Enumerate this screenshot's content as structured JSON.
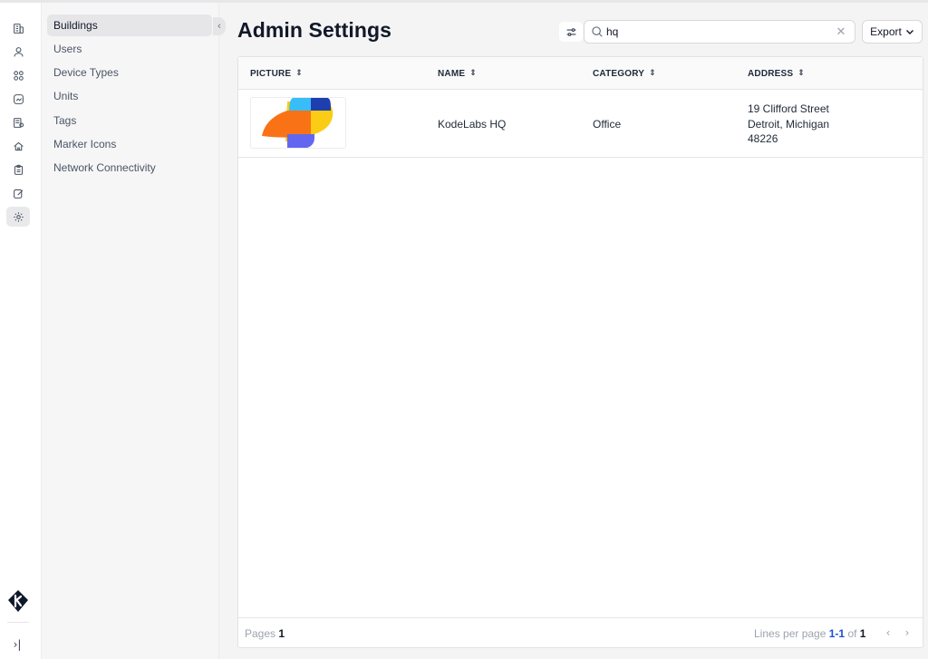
{
  "app": {
    "title": "Admin Settings"
  },
  "rail": {
    "items": [
      {
        "icon": "building-icon"
      },
      {
        "icon": "users-icon"
      },
      {
        "icon": "devices-icon"
      },
      {
        "icon": "analytics-icon"
      },
      {
        "icon": "database-icon"
      },
      {
        "icon": "home-icon"
      },
      {
        "icon": "clipboard-icon"
      },
      {
        "icon": "edit-icon"
      },
      {
        "icon": "settings-icon",
        "active": true
      }
    ],
    "expand_label": "›|"
  },
  "submenu": {
    "items": [
      {
        "label": "Buildings",
        "active": true
      },
      {
        "label": "Users"
      },
      {
        "label": "Device Types"
      },
      {
        "label": "Units"
      },
      {
        "label": "Tags"
      },
      {
        "label": "Marker Icons"
      },
      {
        "label": "Network Connectivity"
      }
    ],
    "collapse_label": "‹"
  },
  "toolbar": {
    "search_value": "hq",
    "clear_label": "✕",
    "export_label": "Export"
  },
  "table": {
    "columns": [
      "PICTURE",
      "NAME",
      "CATEGORY",
      "ADDRESS"
    ],
    "sort_glyph": "⇕",
    "rows": [
      {
        "name": "KodeLabs HQ",
        "category": "Office",
        "address": [
          "19 Clifford Street",
          "Detroit, Michigan",
          "48226"
        ]
      }
    ]
  },
  "footer": {
    "pages_label": "Pages",
    "pages_value": "1",
    "lines_label": "Lines per page",
    "range": "1-1",
    "of_label": "of",
    "total": "1",
    "prev": "‹",
    "next": "›"
  },
  "colors": {
    "accent": "#1d4ed8",
    "logo_orange": "#f97316",
    "logo_yellow": "#facc15",
    "logo_blue": "#1e40af",
    "logo_sky": "#38bdf8",
    "logo_purple": "#6366f1"
  }
}
